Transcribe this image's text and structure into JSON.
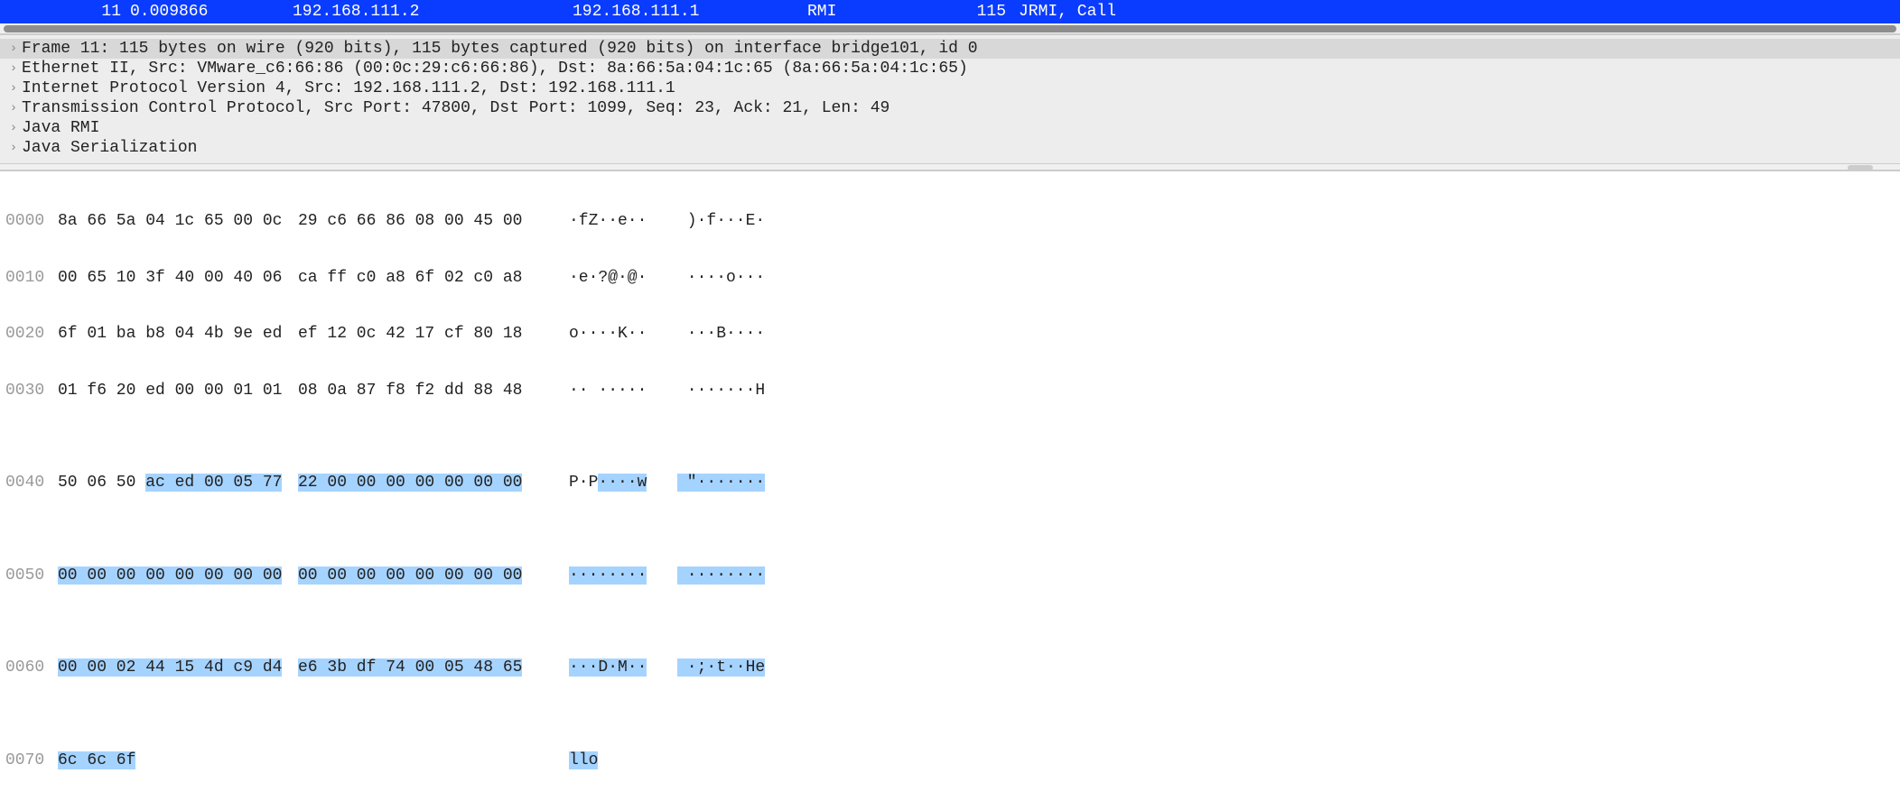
{
  "packet": {
    "no": "11",
    "time": "0.009866",
    "src": "192.168.111.2",
    "dst": "192.168.111.1",
    "proto": "RMI",
    "len": "115",
    "info": "JRMI, Call"
  },
  "details": [
    "Frame 11: 115 bytes on wire (920 bits), 115 bytes captured (920 bits) on interface bridge101, id 0",
    "Ethernet II, Src: VMware_c6:66:86 (00:0c:29:c6:66:86), Dst: 8a:66:5a:04:1c:65 (8a:66:5a:04:1c:65)",
    "Internet Protocol Version 4, Src: 192.168.111.2, Dst: 192.168.111.1",
    "Transmission Control Protocol, Src Port: 47800, Dst Port: 1099, Seq: 23, Ack: 21, Len: 49",
    "Java RMI",
    "Java Serialization"
  ],
  "hex": {
    "rows": [
      {
        "offset": "0000",
        "b1": "8a 66 5a 04 1c 65 00 0c",
        "b2": "29 c6 66 86 08 00 45 00",
        "a1": "·fZ··e··",
        "a2": " )·f···E·"
      },
      {
        "offset": "0010",
        "b1": "00 65 10 3f 40 00 40 06",
        "b2": "ca ff c0 a8 6f 02 c0 a8",
        "a1": "·e·?@·@·",
        "a2": " ····o···"
      },
      {
        "offset": "0020",
        "b1": "6f 01 ba b8 04 4b 9e ed",
        "b2": "ef 12 0c 42 17 cf 80 18",
        "a1": "o····K··",
        "a2": " ···B····"
      },
      {
        "offset": "0030",
        "b1": "01 f6 20 ed 00 00 01 01",
        "b2": "08 0a 87 f8 f2 dd 88 48",
        "a1": "·· ·····",
        "a2": " ·······H"
      }
    ],
    "row40": {
      "offset": "0040",
      "b1_pre": "50 06 50 ",
      "b1_hl": "ac ed 00 05 77",
      "b2_hl": "22 00 00 00 00 00 00 00",
      "a1_pre": "P·P",
      "a1_hl": "····w",
      "a2_hl": " \"·······"
    },
    "row50": {
      "offset": "0050",
      "b1_hl": "00 00 00 00 00 00 00 00",
      "b2_hl": "00 00 00 00 00 00 00 00",
      "a1_hl": "········",
      "a2_hl": " ········"
    },
    "row60": {
      "offset": "0060",
      "b1_hl": "00 00 02 44 15 4d c9 d4",
      "b2_hl": "e6 3b df 74 00 05 48 65",
      "a1_hl": "···D·M··",
      "a2_hl": " ·;·t··He"
    },
    "row70": {
      "offset": "0070",
      "b1_hl": "6c 6c 6f",
      "a1_hl": "llo"
    }
  }
}
